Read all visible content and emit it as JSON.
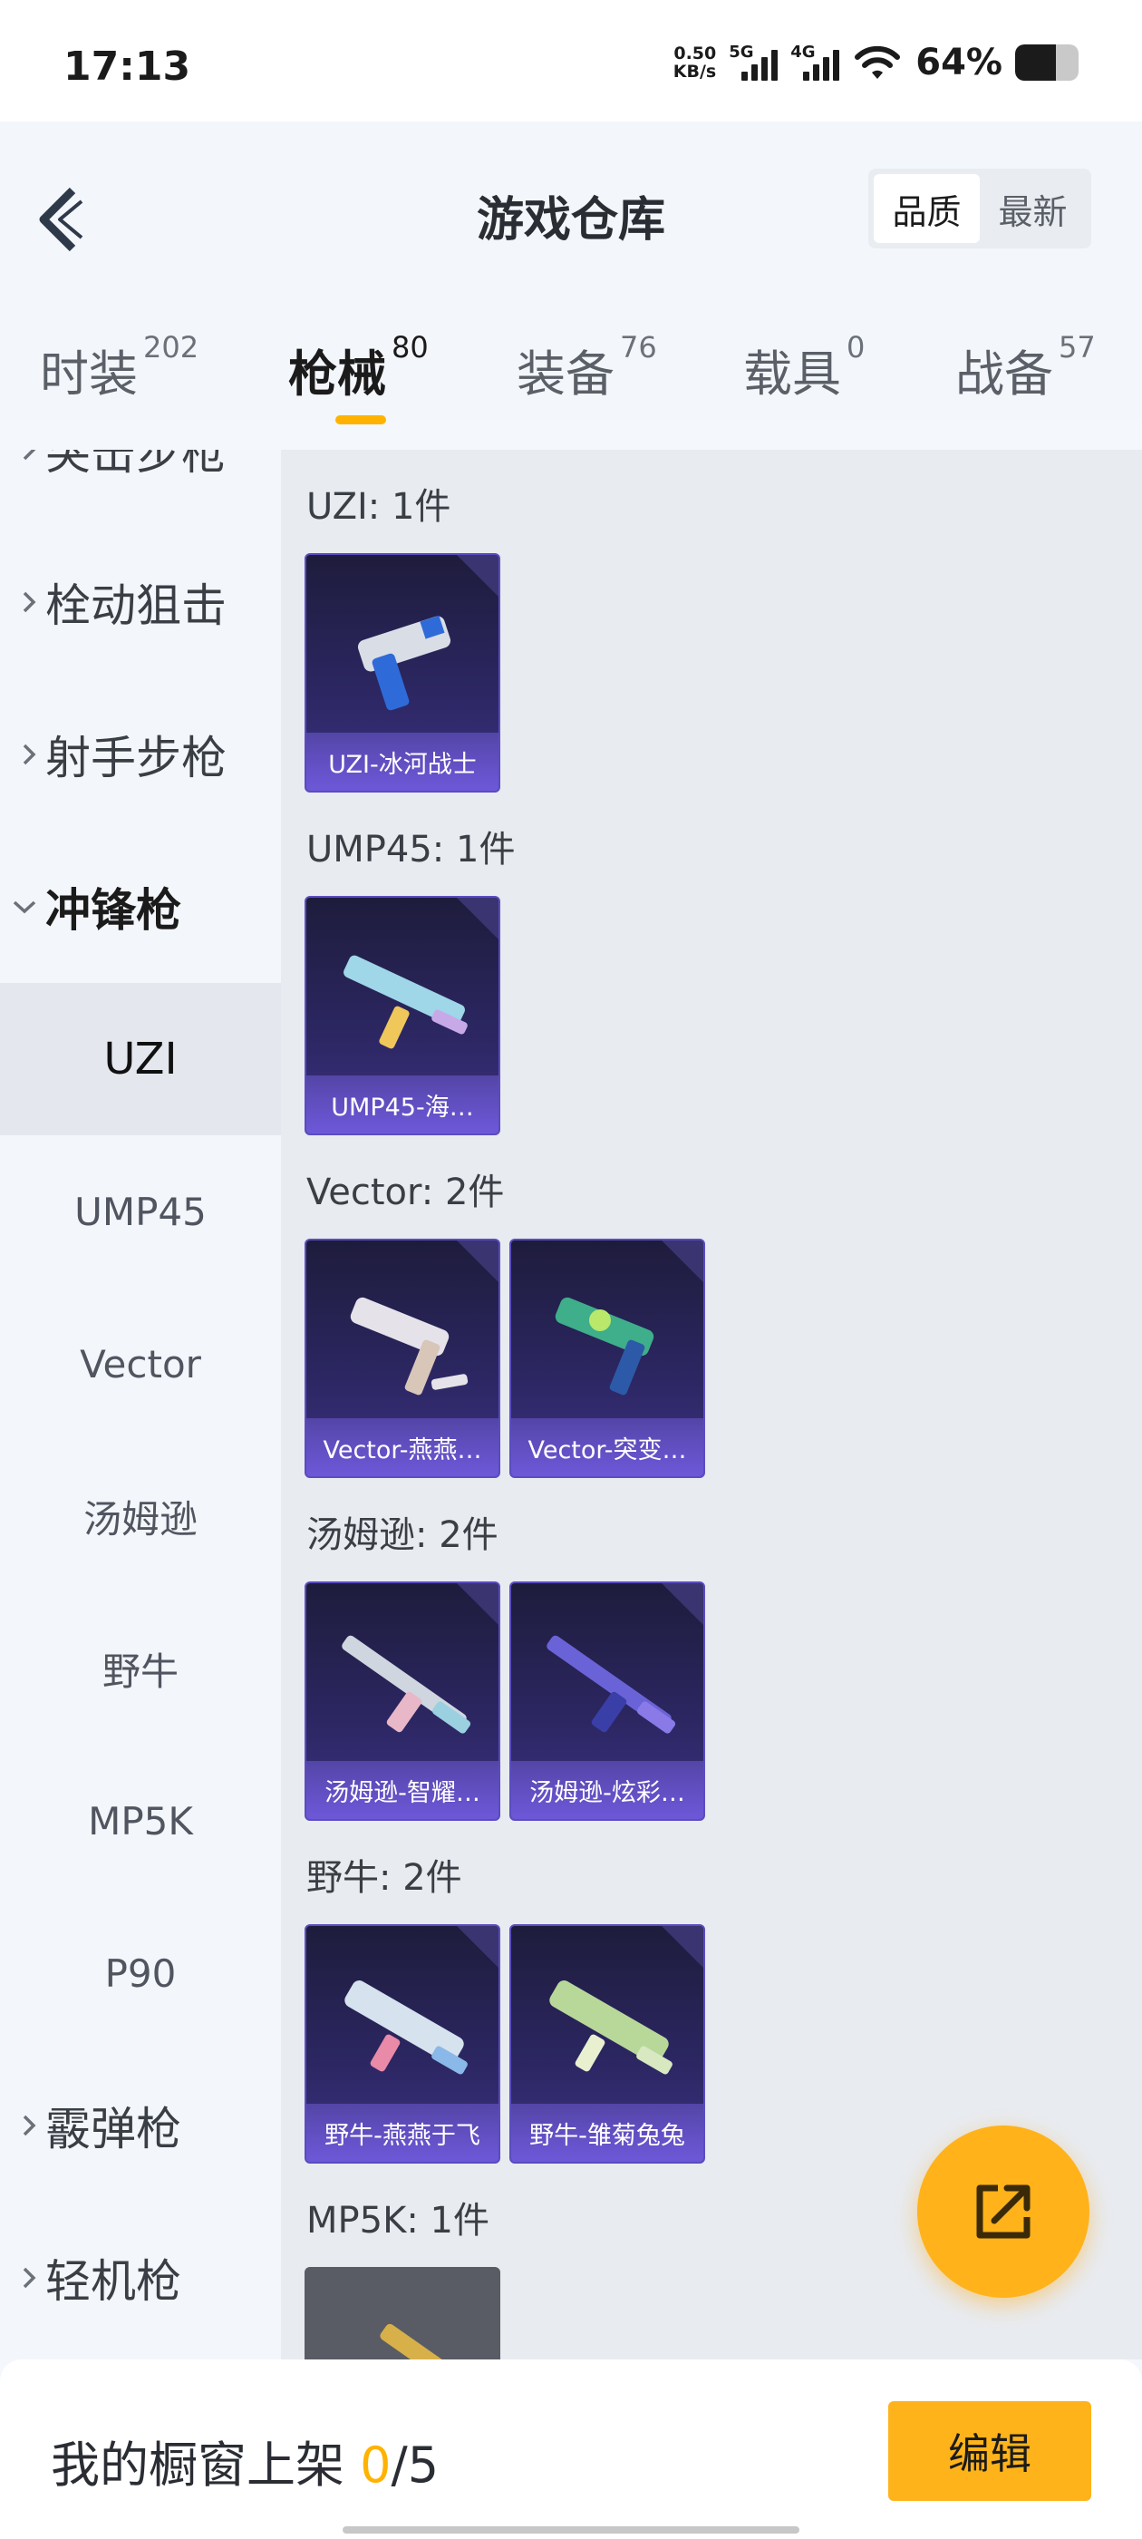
{
  "status_bar": {
    "time": "17:13",
    "net_speed_value": "0.50",
    "net_speed_unit": "KB/s",
    "sim1_label": "5G",
    "sim2_label": "4G",
    "battery_percent": "64%",
    "battery_level": 0.64
  },
  "header": {
    "title": "游戏仓库",
    "sort_options": [
      "品质",
      "最新"
    ],
    "sort_selected": "品质"
  },
  "tabs": [
    {
      "label": "时装",
      "count": "202"
    },
    {
      "label": "枪械",
      "count": "80",
      "active": true
    },
    {
      "label": "装备",
      "count": "76"
    },
    {
      "label": "载具",
      "count": "0"
    },
    {
      "label": "战备",
      "count": "57"
    }
  ],
  "sidebar": {
    "partial_top": "突击步枪",
    "categories": {
      "bolt": "栓动狙击",
      "marksman": "射手步枪",
      "smg": "冲锋枪",
      "shotgun": "霰弹枪",
      "lmg": "轻机枪"
    },
    "smg_items": [
      "UZI",
      "UMP45",
      "Vector",
      "汤姆逊",
      "野牛",
      "MP5K",
      "P90"
    ],
    "selected": "UZI"
  },
  "content": {
    "groups": [
      {
        "title": "UZI: 1件",
        "items": [
          "UZI-冰河战士"
        ]
      },
      {
        "title": "UMP45: 1件",
        "items": [
          "UMP45-海…"
        ]
      },
      {
        "title": "Vector: 2件",
        "items": [
          "Vector-燕燕…",
          "Vector-突变…"
        ]
      },
      {
        "title": "汤姆逊: 2件",
        "items": [
          "汤姆逊-智耀…",
          "汤姆逊-炫彩…"
        ]
      },
      {
        "title": "野牛: 2件",
        "items": [
          "野牛-燕燕于飞",
          "野牛-雏菊兔兔"
        ]
      },
      {
        "title": "MP5K: 1件",
        "items": [
          ""
        ]
      }
    ]
  },
  "bottom_bar": {
    "shelf_label": "我的橱窗上架",
    "shelf_current": "0",
    "shelf_max": "/5",
    "edit_label": "编辑"
  },
  "colors": {
    "accent": "#ffb300",
    "card_bg": "#2b2660",
    "card_label": "#6d58d8"
  }
}
